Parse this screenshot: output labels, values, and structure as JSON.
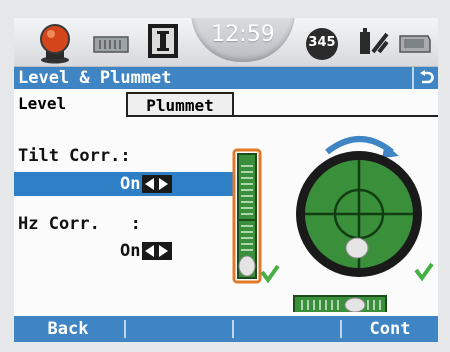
{
  "status": {
    "time": "12:59",
    "timer_label": "345",
    "icons": [
      "bell-icon",
      "battery-small-icon",
      "instrument-mode-icon",
      "timer-icon",
      "antenna-icon",
      "memory-card-icon"
    ]
  },
  "titlebar": {
    "title": "Level & Plummet",
    "back_icon": "back-arrow-icon"
  },
  "tabs": [
    {
      "label": "Level",
      "active": true
    },
    {
      "label": "Plummet",
      "active": false
    }
  ],
  "fields": {
    "tilt": {
      "label": "Tilt Corr.:",
      "value": "On",
      "selected": true
    },
    "hz": {
      "label": "Hz Corr.   :",
      "value": "On",
      "selected": false
    }
  },
  "level": {
    "colors": {
      "bubble_green": "#3a8f3a",
      "check_green": "#46b046",
      "selected_orange": "#e07a2a",
      "accent_blue": "#3f84c3"
    }
  },
  "footer": {
    "left": "Back",
    "right": "Cont"
  }
}
